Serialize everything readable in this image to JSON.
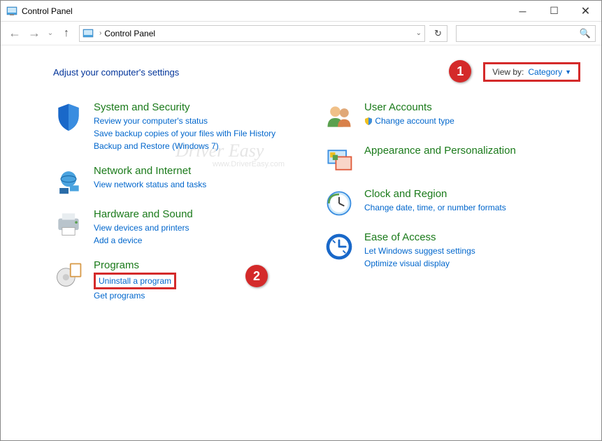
{
  "window": {
    "title": "Control Panel"
  },
  "nav": {
    "breadcrumb": "Control Panel",
    "search_placeholder": ""
  },
  "header": {
    "title": "Adjust your computer's settings",
    "viewby_label": "View by:",
    "viewby_value": "Category"
  },
  "callouts": {
    "one": "1",
    "two": "2"
  },
  "left": {
    "system": {
      "title": "System and Security",
      "l1": "Review your computer's status",
      "l2": "Save backup copies of your files with File History",
      "l3": "Backup and Restore (Windows 7)"
    },
    "network": {
      "title": "Network and Internet",
      "l1": "View network status and tasks"
    },
    "hardware": {
      "title": "Hardware and Sound",
      "l1": "View devices and printers",
      "l2": "Add a device"
    },
    "programs": {
      "title": "Programs",
      "l1": "Uninstall a program",
      "l2": "Get programs"
    }
  },
  "right": {
    "users": {
      "title": "User Accounts",
      "l1": "Change account type"
    },
    "appearance": {
      "title": "Appearance and Personalization"
    },
    "clock": {
      "title": "Clock and Region",
      "l1": "Change date, time, or number formats"
    },
    "ease": {
      "title": "Ease of Access",
      "l1": "Let Windows suggest settings",
      "l2": "Optimize visual display"
    }
  },
  "watermark": {
    "main": "Driver Easy",
    "sub": "www.DriverEasy.com"
  }
}
